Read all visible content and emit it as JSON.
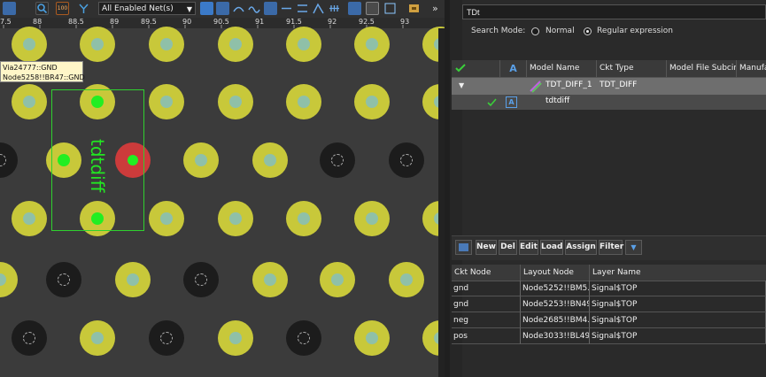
{
  "toolbar": {
    "net_filter": "All Enabled Net(s)",
    "overflow": "»"
  },
  "ruler": {
    "ticks": [
      "7.5",
      "88",
      "88.5",
      "89",
      "89.5",
      "90",
      "90.5",
      "91",
      "91.5",
      "92",
      "92.5",
      "93"
    ]
  },
  "tooltip": {
    "line1": "Via24777::GND",
    "line2": "Node5258!!BR47::GND"
  },
  "canvas": {
    "component_label": "tdtdiff"
  },
  "search": {
    "value": "TDt",
    "mode_label": "Search Mode:",
    "normal_label": "Normal",
    "regex_label": "Regular expression",
    "selected_mode": "regex"
  },
  "model_table": {
    "columns": [
      "",
      "",
      "Model Name",
      "Ckt Type",
      "Model File Subcirc",
      "Manufa"
    ],
    "rows": [
      {
        "name": "TDT_DIFF_1",
        "ckt_type": "TDT_DIFF",
        "expanded": true
      },
      {
        "name": "tdtdiff",
        "ckt_type": "",
        "child": true
      }
    ]
  },
  "buttons": {
    "new": "New",
    "del": "Del",
    "edit": "Edit",
    "load": "Load",
    "assign": "Assign",
    "filter": "Filter",
    "filter_dropdown": "▼"
  },
  "node_table": {
    "columns": [
      "Ckt Node",
      "Layout Node",
      "Layer Name"
    ],
    "rows": [
      [
        "gnd",
        "Node5252!!BM5...",
        "Signal$TOP"
      ],
      [
        "gnd",
        "Node5253!!BN49...",
        "Signal$TOP"
      ],
      [
        "neg",
        "Node2685!!BM4...",
        "Signal$TOP"
      ],
      [
        "pos",
        "Node3033!!BL49...",
        "Signal$TOP"
      ]
    ]
  },
  "colors": {
    "via_ring": "#c8c83a",
    "via_dark": "#1c1c1c",
    "pin_green": "#22ee22",
    "pin_red": "#cc3b3b",
    "selection_gray": "#6e6e6e"
  }
}
